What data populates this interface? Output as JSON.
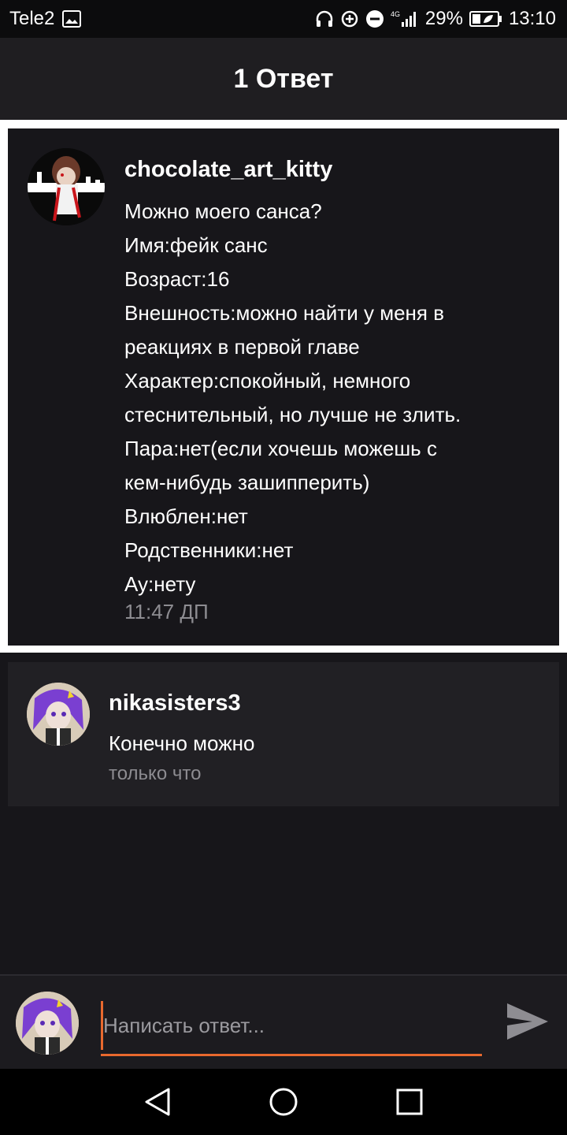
{
  "status_bar": {
    "carrier": "Tele2",
    "network": "4G",
    "battery": "29%",
    "time": "13:10",
    "icons": [
      "image-icon",
      "headphones-icon",
      "data-saver-icon",
      "do-not-disturb-icon",
      "signal-icon",
      "battery-icon"
    ]
  },
  "header": {
    "title": "1 Ответ"
  },
  "original_comment": {
    "author": "chocolate_art_kitty",
    "lines": [
      "Можно моего санса?",
      "Имя:фейк санс",
      "Возраст:16",
      "Внешность:можно найти у меня в",
      "реакциях в первой главе",
      "Характер:спокойный, немного",
      "стеснительный, но лучше не злить.",
      "Пара:нет(если хочешь можешь с",
      "кем-нибудь зашипперить)",
      "Влюблен:нет",
      "Родственники:нет",
      "Ау:нету"
    ],
    "time": "11:47 ДП"
  },
  "reply": {
    "author": "nikasisters3",
    "text": "Конечно можно",
    "time": "только что"
  },
  "compose": {
    "placeholder": "Написать ответ...",
    "accent_color": "#e8692e"
  },
  "nav": {
    "buttons": [
      "back-icon",
      "home-icon",
      "recents-icon"
    ]
  },
  "colors": {
    "background": "#17161a",
    "header": "#1f1e21",
    "reply_card": "#212024",
    "muted_text": "#8d8c91"
  }
}
